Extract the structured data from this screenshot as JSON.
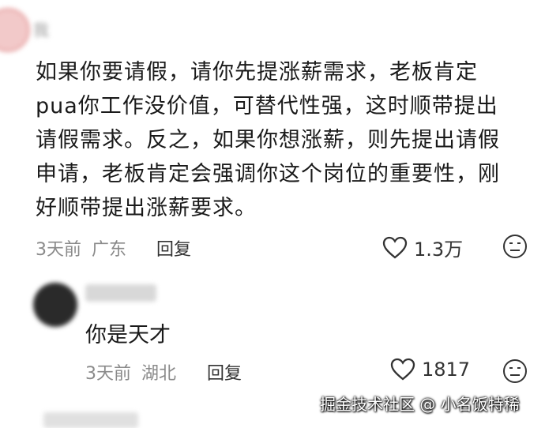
{
  "top_comment": {
    "username": "我",
    "text": "如果你要请假，请你先提涨薪需求，老板肯定\npua你工作没价值，可替代性强，这时顺带提出\n请假需求。反之，如果你想涨薪，则先提出请假\n申请，老板肯定会强调你这个岗位的重要性，刚\n好顺带提出涨薪要求。",
    "time": "3天前",
    "location": "广东",
    "reply_label": "回复",
    "likes": "1.3万"
  },
  "reply_comment": {
    "text": "你是天才",
    "time": "3天前",
    "location": "湖北",
    "reply_label": "回复",
    "likes": "1817"
  },
  "watermark": "掘金技术社区 @ 小名饭特稀"
}
